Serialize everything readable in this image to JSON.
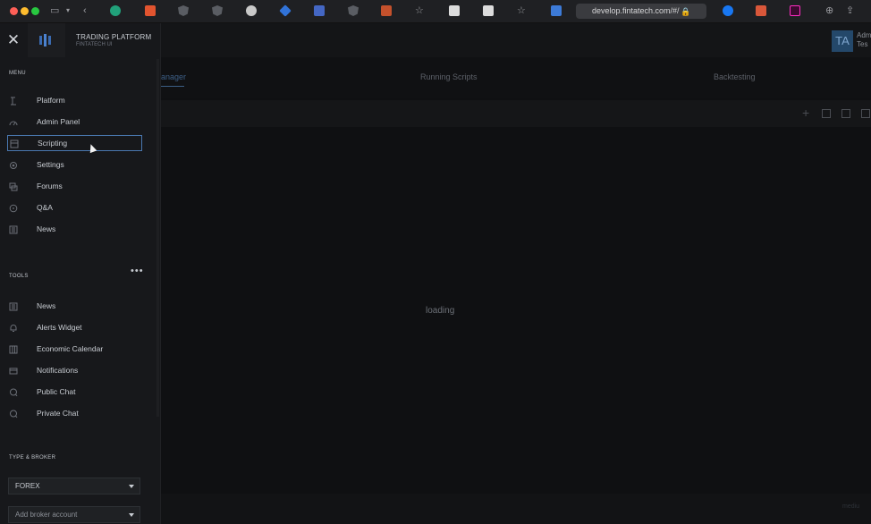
{
  "browser": {
    "url": "develop.fintatech.com/#/"
  },
  "header": {
    "avatar_initials": "TA",
    "avatar_line1": "Adm",
    "avatar_line2": "Tes"
  },
  "brand": {
    "title": "TRADING PLATFORM",
    "subtitle": "FINTATECH UI"
  },
  "menu": {
    "label": "MENU",
    "items": [
      {
        "label": "Platform",
        "icon": "platform-icon"
      },
      {
        "label": "Admin Panel",
        "icon": "gauge-icon"
      },
      {
        "label": "Scripting",
        "icon": "script-icon"
      },
      {
        "label": "Settings",
        "icon": "gear-icon"
      },
      {
        "label": "Forums",
        "icon": "forum-icon"
      },
      {
        "label": "Q&A",
        "icon": "question-icon"
      },
      {
        "label": "News",
        "icon": "newspaper-icon"
      }
    ]
  },
  "tools": {
    "label": "TOOLS",
    "items": [
      {
        "label": "News",
        "icon": "newspaper-icon"
      },
      {
        "label": "Alerts Widget",
        "icon": "bell-icon"
      },
      {
        "label": "Economic Calendar",
        "icon": "calendar-icon"
      },
      {
        "label": "Notifications",
        "icon": "notification-icon"
      },
      {
        "label": "Public Chat",
        "icon": "chat-icon"
      },
      {
        "label": "Private Chat",
        "icon": "chat-bubble-icon"
      }
    ]
  },
  "type_broker": {
    "label": "TYPE & BROKER",
    "type_value": "FOREX",
    "broker_placeholder": "Add broker account"
  },
  "main": {
    "tabs": [
      {
        "label": "anager"
      },
      {
        "label": "Running Scripts"
      },
      {
        "label": "Backtesting"
      }
    ],
    "loading_text": "loading",
    "footer_note": "mediu"
  },
  "colors": {
    "accent": "#4a78b0",
    "sidebar_bg": "#17181b",
    "app_bg": "#0f1012"
  }
}
